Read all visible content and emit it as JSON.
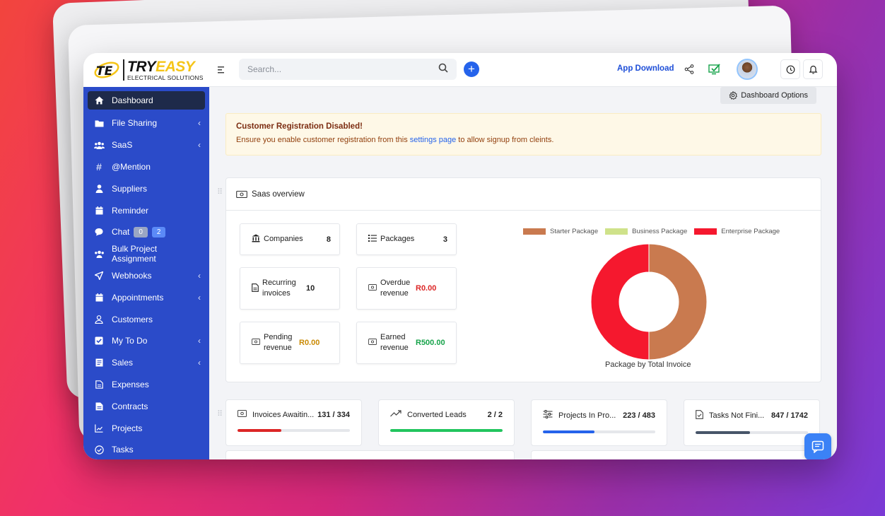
{
  "brand": {
    "logo_try": "TRY",
    "logo_easy": "EASY",
    "logo_subtitle": "ELECTRICAL SOLUTIONS",
    "accent": "#f5c518"
  },
  "topbar": {
    "search_placeholder": "Search...",
    "app_download": "App Download"
  },
  "sidebar": {
    "color": "#2b4bc9",
    "items": [
      {
        "label": "Dashboard",
        "icon": "home-icon",
        "active": true
      },
      {
        "label": "File Sharing",
        "icon": "folder-icon",
        "chevron": true
      },
      {
        "label": "SaaS",
        "icon": "users-icon",
        "chevron": true
      },
      {
        "label": "@Mention",
        "icon": "hash-icon"
      },
      {
        "label": "Suppliers",
        "icon": "user-icon"
      },
      {
        "label": "Reminder",
        "icon": "calendar-icon"
      },
      {
        "label": "Chat",
        "icon": "chat-icon",
        "badges": [
          "0",
          "2"
        ]
      },
      {
        "label": "Bulk Project Assignment",
        "icon": "users-icon"
      },
      {
        "label": "Webhooks",
        "icon": "send-icon",
        "chevron": true
      },
      {
        "label": "Appointments",
        "icon": "calendar-icon",
        "chevron": true
      },
      {
        "label": "Customers",
        "icon": "user-outline-icon"
      },
      {
        "label": "My To Do",
        "icon": "checkbox-icon",
        "chevron": true
      },
      {
        "label": "Sales",
        "icon": "receipt-icon",
        "chevron": true
      },
      {
        "label": "Expenses",
        "icon": "file-icon"
      },
      {
        "label": "Contracts",
        "icon": "contract-icon"
      },
      {
        "label": "Projects",
        "icon": "chart-icon"
      },
      {
        "label": "Tasks",
        "icon": "check-circle-icon"
      }
    ]
  },
  "main": {
    "dashboard_options": "Dashboard Options",
    "alert": {
      "title": "Customer Registration Disabled!",
      "msg_before": "Ensure you enable customer registration from this ",
      "link": "settings page",
      "msg_after": " to allow signup from cleints."
    },
    "saas": {
      "title": "Saas overview",
      "stats": [
        {
          "label": "Companies",
          "value": "8"
        },
        {
          "label": "Packages",
          "value": "3"
        },
        {
          "label": "Recurring invoices",
          "value": "10"
        },
        {
          "label": "Overdue revenue",
          "value": "R0.00",
          "color": "#dc2626"
        },
        {
          "label": "Pending revenue",
          "value": "R0.00",
          "color": "#ca8a04"
        },
        {
          "label": "Earned revenue",
          "value": "R500.00",
          "color": "#16a34a"
        }
      ]
    },
    "cards": [
      {
        "label": "Invoices Awaitin...",
        "value": "131 / 334",
        "progress": 0.392,
        "color": "#dc2626"
      },
      {
        "label": "Converted Leads",
        "value": "2 / 2",
        "progress": 1.0,
        "color": "#22c55e"
      },
      {
        "label": "Projects In Pro...",
        "value": "223 / 483",
        "progress": 0.462,
        "color": "#2563eb"
      },
      {
        "label": "Tasks Not Fini...",
        "value": "847 / 1742",
        "progress": 0.486,
        "color": "#475569"
      }
    ]
  },
  "chart_data": {
    "type": "pie",
    "title": "Package by Total Invoice",
    "legend_position": "top",
    "categories": [
      "Starter Package",
      "Business Package",
      "Enterprise Package"
    ],
    "values": [
      50,
      0,
      50
    ],
    "colors": [
      "#c97a4f",
      "#cfe28a",
      "#f5182e"
    ]
  }
}
